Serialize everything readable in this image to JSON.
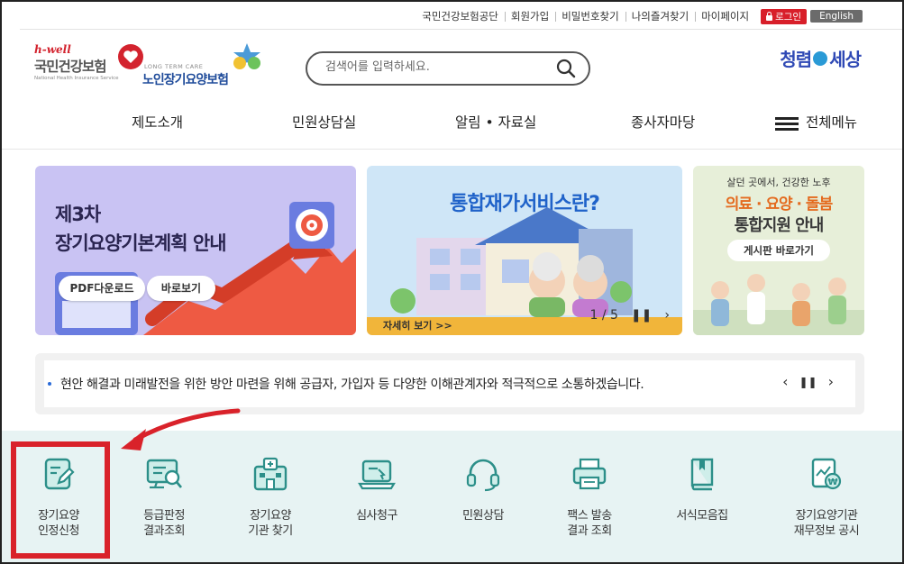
{
  "util_links": [
    "국민건강보험공단",
    "회원가입",
    "비밀번호찾기",
    "나의즐겨찾기",
    "마이페이지"
  ],
  "login_label": "로그인",
  "english_label": "English",
  "logo_nhis": {
    "tag": "h-well",
    "name": "국민건강보험",
    "sub": "National Health Insurance Service"
  },
  "logo_ltc": {
    "small": "LONG TERM CARE",
    "name": "노인장기요양보험"
  },
  "logo_clean": {
    "left": "청렴",
    "right": "세상"
  },
  "search": {
    "placeholder": "검색어를 입력하세요."
  },
  "nav": [
    "제도소개",
    "민원상담실",
    "알림 • 자료실",
    "종사자마당"
  ],
  "all_menu_label": "전체메뉴",
  "banners": {
    "b1": {
      "title_1": "제3차",
      "title_2": "장기요양기본계획 안내",
      "btn_pdf": "PDF다운로드",
      "btn_view": "바로보기"
    },
    "b2": {
      "title": "통합재가서비스란?",
      "more": "자세히 보기 >>",
      "pager": "1 / 5"
    },
    "b3": {
      "line1": "살던 곳에서, 건강한 노후",
      "line2": "의료 · 요양 · 돌봄",
      "line3": "통합지원 안내",
      "btn": "게시판 바로가기"
    }
  },
  "notice": "현안 해결과 미래발전을 위한 방안 마련을 위해 공급자, 가입자 등 다양한 이해관계자와 적극적으로 소통하겠습니다.",
  "quick": [
    {
      "l1": "장기요양",
      "l2": "인정신청"
    },
    {
      "l1": "등급판정",
      "l2": "결과조회"
    },
    {
      "l1": "장기요양",
      "l2": "기관 찾기"
    },
    {
      "l1": "심사청구",
      "l2": ""
    },
    {
      "l1": "민원상담",
      "l2": ""
    },
    {
      "l1": "팩스 발송",
      "l2": "결과 조회"
    },
    {
      "l1": "서식모음집",
      "l2": ""
    },
    {
      "l1": "장기요양기관",
      "l2": "재무정보 공시"
    }
  ],
  "colors": {
    "accent_red": "#d9222a",
    "quick_bg": "#e7f3f3",
    "icon_teal": "#2c8f89"
  }
}
